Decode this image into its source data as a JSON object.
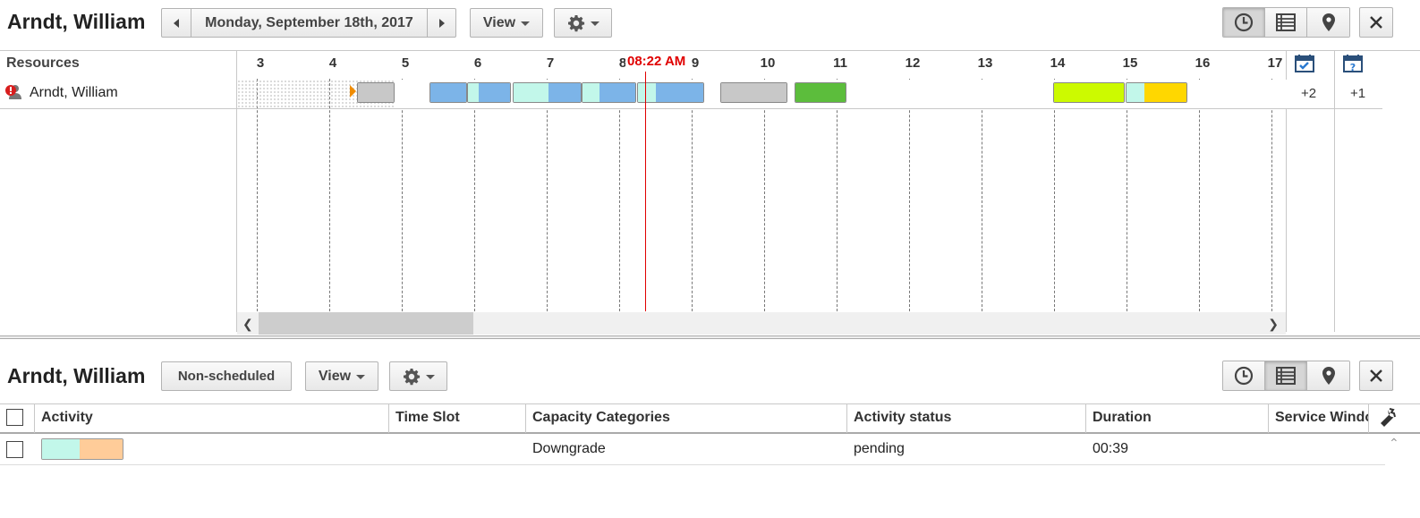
{
  "colors": {
    "now_line": "#e00000",
    "appt_blue": "#7cb4e8",
    "appt_cyan": "#c2f7ea",
    "appt_gray": "#c8c8c8",
    "appt_green": "#5cbd3c",
    "appt_lime": "#ccfa00",
    "appt_yellow": "#ffd700",
    "appt_orange": "#ffcc99",
    "marker_orange": "#f08c00"
  },
  "top": {
    "resource_title": "Arndt, William",
    "date_label": "Monday, September 18th, 2017",
    "view_label": "View",
    "resources_header": "Resources",
    "resource_name": "Arndt, William",
    "hours": [
      "3",
      "4",
      "5",
      "6",
      "7",
      "8",
      "9",
      "10",
      "11",
      "12",
      "13",
      "14",
      "15",
      "16",
      "17"
    ],
    "now_time": "08:22 AM",
    "counter_1": "+2",
    "counter_2": "+1",
    "icons": {
      "prev": "prev-arrow-icon",
      "next": "next-arrow-icon",
      "settings": "gear-icon",
      "time_view": "clock-icon",
      "list_view": "list-icon",
      "map_view": "map-pin-icon",
      "close": "close-icon",
      "resource_alert": "alert-person-icon",
      "cal_ok": "calendar-check-icon",
      "cal_unknown": "calendar-question-icon"
    }
  },
  "bottom": {
    "resource_title": "Arndt, William",
    "non_scheduled_label": "Non-scheduled",
    "view_label": "View",
    "columns": [
      "Activity",
      "Time Slot",
      "Capacity Categories",
      "Activity status",
      "Duration",
      "Service Window"
    ],
    "rows": [
      {
        "time_slot": "",
        "capacity": "Downgrade",
        "status": "pending",
        "duration": "00:39"
      }
    ]
  }
}
